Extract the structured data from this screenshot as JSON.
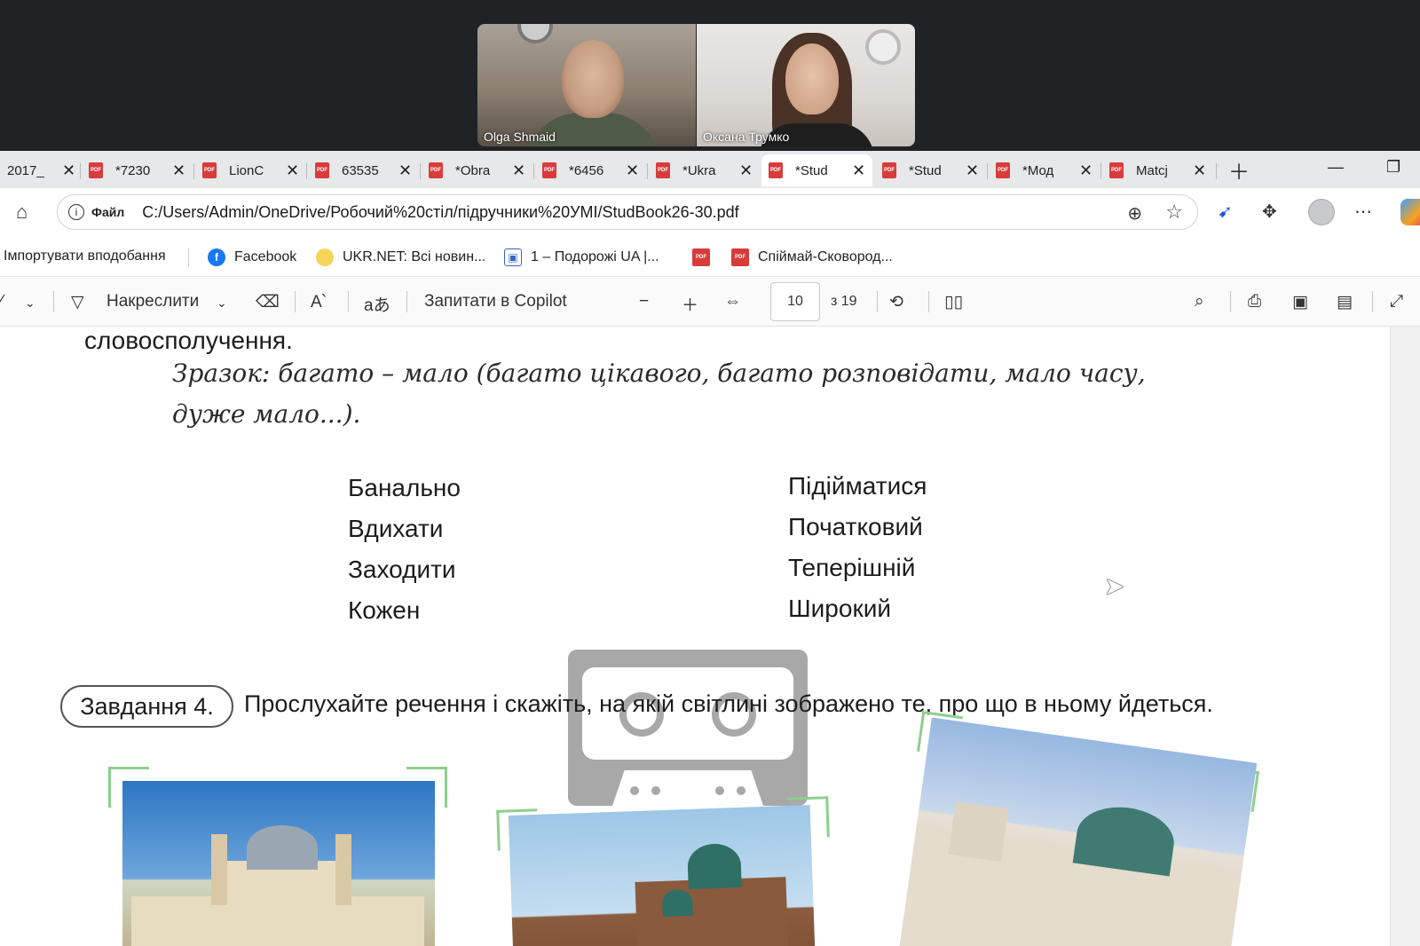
{
  "call": {
    "participants": [
      {
        "name": "Olga Shmaid"
      },
      {
        "name": "Оксана Трумко"
      }
    ]
  },
  "tabs": [
    {
      "label": "2017_",
      "pdf": false
    },
    {
      "label": "*7230",
      "pdf": true
    },
    {
      "label": "LionC",
      "pdf": true
    },
    {
      "label": "63535",
      "pdf": true
    },
    {
      "label": "*Obra",
      "pdf": true
    },
    {
      "label": "*6456",
      "pdf": true
    },
    {
      "label": "*Ukra",
      "pdf": true
    },
    {
      "label": "*Stud",
      "pdf": true,
      "active": true
    },
    {
      "label": "*Stud",
      "pdf": true
    },
    {
      "label": "*Мод",
      "pdf": true
    },
    {
      "label": "Matcj",
      "pdf": true
    }
  ],
  "address": {
    "scheme_label": "Файл",
    "url": "C:/Users/Admin/OneDrive/Робочий%20стіл/підручники%20УМІ/StudBook26-30.pdf"
  },
  "bookmarks": [
    {
      "label": "Імпортувати вподобання",
      "icon": "none"
    },
    {
      "label": "Facebook",
      "icon": "facebook-icon"
    },
    {
      "label": "UKR.NET: Всі новин...",
      "icon": "ukrnet-icon"
    },
    {
      "label": "1 – Подорожі UA |...",
      "icon": "bus-icon"
    },
    {
      "label": "",
      "icon": "pdf-icon"
    },
    {
      "label": "Спіймай-Сковород...",
      "icon": "pdf-icon"
    }
  ],
  "pdf_toolbar": {
    "draw_label": "Накреслити",
    "copilot_label": "Запитати в Copilot",
    "page_current": "10",
    "page_total": "з 19"
  },
  "document": {
    "line_top": "словосполучення.",
    "example_line1": "Зразок: багато – мало (багато цікавого, багато розповідати, мало часу,",
    "example_line2": "дуже мало...).",
    "words_left": [
      "Банально",
      "Вдихати",
      "Заходити",
      "Кожен"
    ],
    "words_right": [
      "Підійматися",
      "Початковий",
      "Теперішній",
      "Широкий"
    ],
    "task_badge": "Завдання 4.",
    "task_text": "Прослухайте речення і скажіть, на якій світлині зображено те, про що в ньому йдеться."
  },
  "colors": {
    "accent_pdf": "#d93b3b",
    "frame_green": "#8dcf8d",
    "tabstrip_bg": "#e7e8ea"
  }
}
